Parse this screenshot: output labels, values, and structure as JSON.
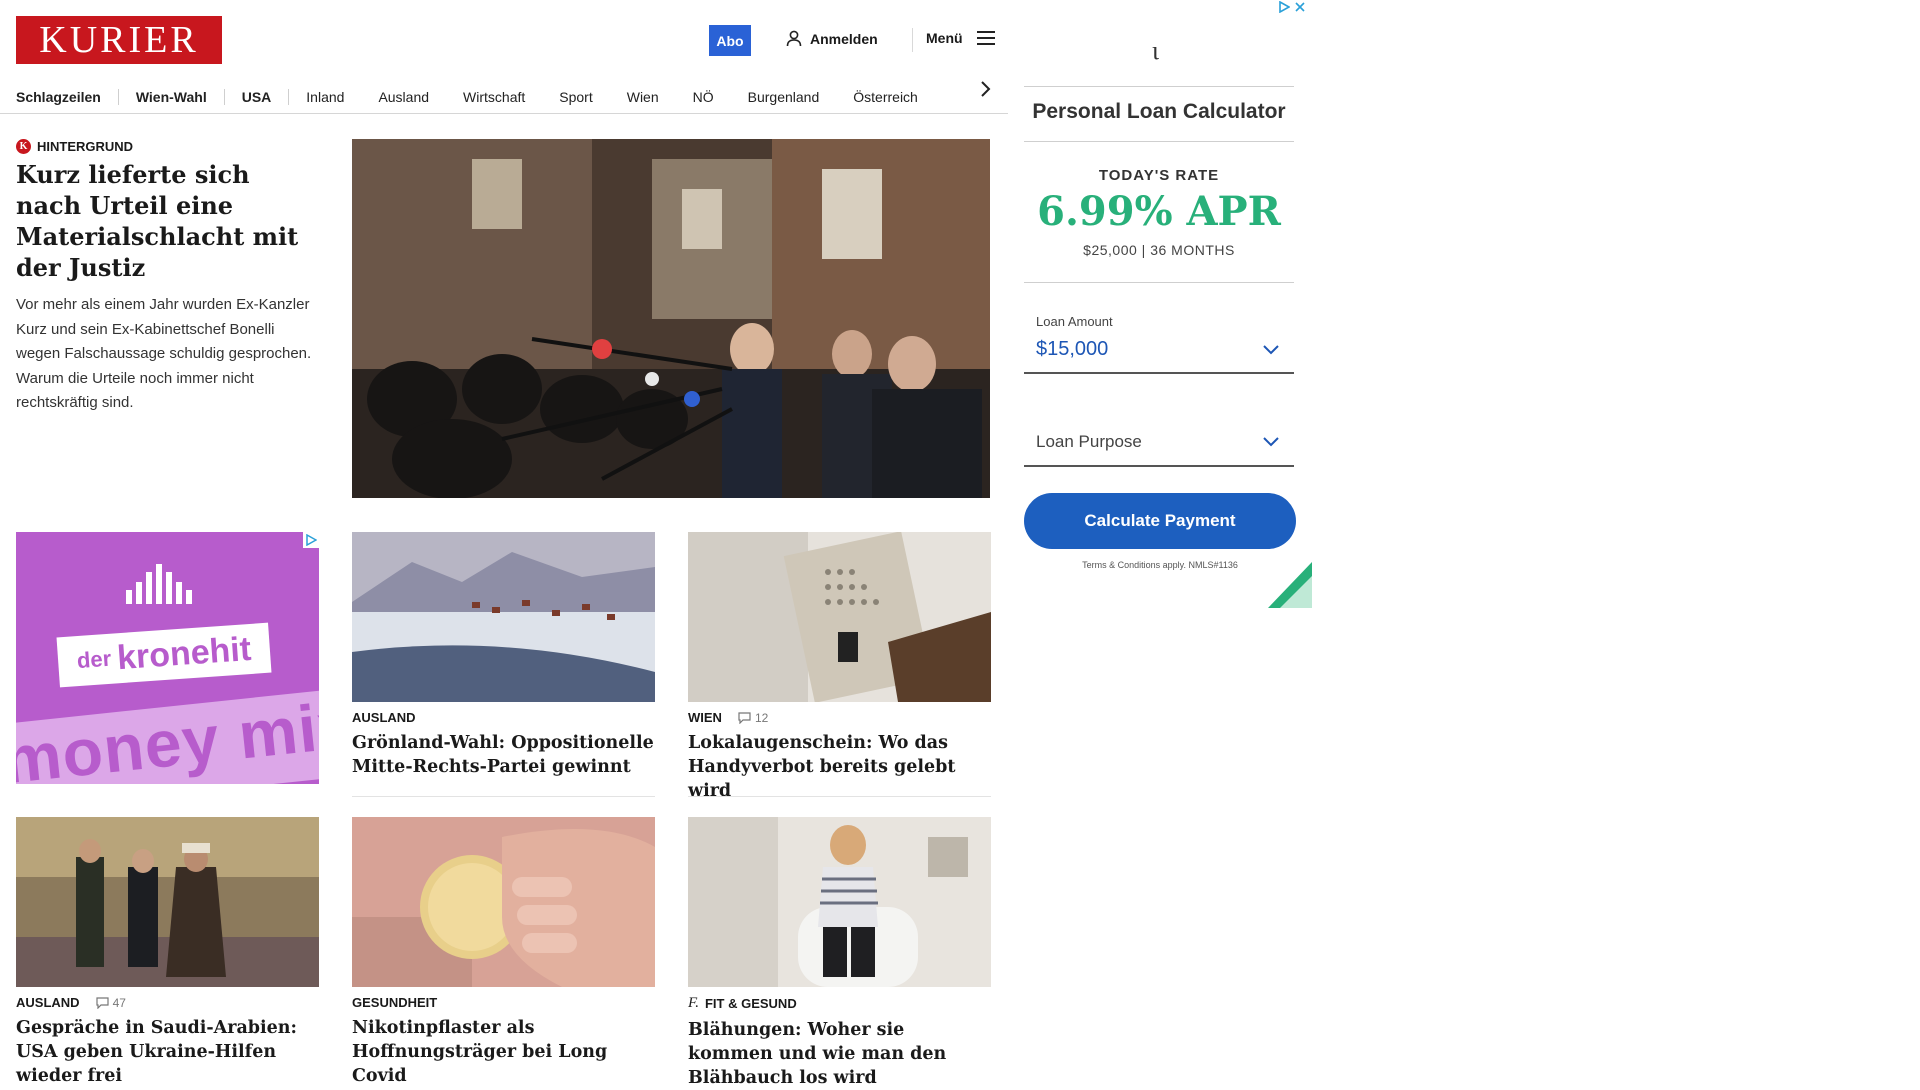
{
  "header": {
    "logo": "KURIER",
    "abo_label": "Abo",
    "login_label": "Anmelden",
    "menu_label": "Menü"
  },
  "nav": {
    "items": [
      "Schlagzeilen",
      "Wien-Wahl",
      "USA",
      "Inland",
      "Ausland",
      "Wirtschaft",
      "Sport",
      "Wien",
      "NÖ",
      "Burgenland",
      "Österreich"
    ]
  },
  "lead": {
    "kicker": "HINTERGRUND",
    "title": "Kurz lieferte sich nach Urteil eine Materialschlacht mit der Justiz",
    "teaser": "Vor mehr als einem Jahr wurden Ex-Kanzler Kurz und sein Ex-Kabinettschef Bonelli wegen Falschaussage schuldig gesprochen. Warum die Urteile noch immer nicht rechtskräftig sind."
  },
  "ad_tile": {
    "brand_prefix": "der",
    "brand_name": "kronehit",
    "tagline": "money mix"
  },
  "cards": [
    {
      "kicker": "AUSLAND",
      "comments": "",
      "title": "Grönland-Wahl: Oppositionelle Mitte-Rechts-Partei gewinnt"
    },
    {
      "kicker": "WIEN",
      "comments": "12",
      "title": "Lokalaugenschein: Wo das Handyverbot bereits gelebt wird"
    },
    {
      "kicker": "AUSLAND",
      "comments": "47",
      "title": "Gespräche in Saudi-Arabien: USA geben Ukraine-Hilfen wieder frei"
    },
    {
      "kicker": "GESUNDHEIT",
      "comments": "",
      "title": "Nikotinpflaster als Hoffnungsträger bei Long Covid"
    },
    {
      "kicker": "FIT & GESUND",
      "comments": "",
      "title": "Blähungen: Woher sie kommen und wie man den Blähbauch los wird"
    }
  ],
  "loan_ad": {
    "title": "Personal Loan Calculator",
    "rate_label": "TODAY'S RATE",
    "rate_value": "6.99% APR",
    "rate_detail": "$25,000 | 36 MONTHS",
    "amount_label": "Loan Amount",
    "amount_value": "$15,000",
    "purpose_placeholder": "Loan Purpose",
    "button_label": "Calculate Payment",
    "terms": "Terms & Conditions apply. NMLS#1136"
  },
  "colors": {
    "brand_red": "#c8171e",
    "abo_blue": "#2a62d6",
    "rate_green": "#28b07a",
    "ad_purple": "#b75ccc",
    "button_blue": "#1d5fbf"
  }
}
